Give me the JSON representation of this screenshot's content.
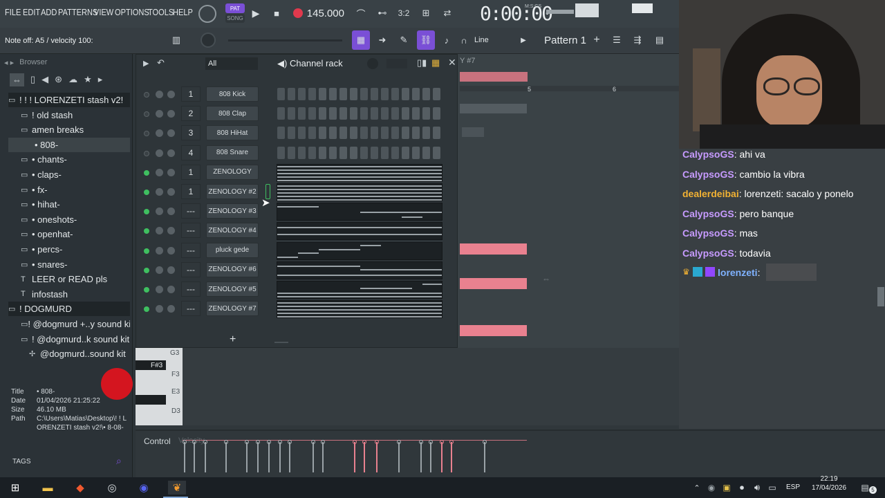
{
  "menu": [
    "FILE",
    "EDIT",
    "ADD",
    "PATTERNS",
    "VIEW",
    "OPTIONS",
    "TOOLS",
    "HELP"
  ],
  "transport": {
    "tempo": "145.000",
    "time": "0:00:00",
    "time_label": "M:S:CS",
    "pat_badge": "PAT",
    "song_badge": "SONG"
  },
  "hint": "Note off: A5 / velocity 100:",
  "toolbar": {
    "snap": "Line",
    "pattern": "Pattern 1"
  },
  "browser": {
    "title": "Browser",
    "items": [
      {
        "label": "! ! ! LORENZETI stash v2!",
        "kind": "folder"
      },
      {
        "label": "! old stash",
        "kind": "sub"
      },
      {
        "label": "amen  breaks",
        "kind": "sub"
      },
      {
        "label": "• 808-",
        "kind": "sel"
      },
      {
        "label": "• chants-",
        "kind": "sub"
      },
      {
        "label": "• claps-",
        "kind": "sub"
      },
      {
        "label": "• fx-",
        "kind": "sub"
      },
      {
        "label": "• hihat-",
        "kind": "sub"
      },
      {
        "label": "• oneshots-",
        "kind": "sub"
      },
      {
        "label": "• openhat-",
        "kind": "sub"
      },
      {
        "label": "• percs-",
        "kind": "sub"
      },
      {
        "label": "• snares-",
        "kind": "sub"
      },
      {
        "label": "LEER or READ pls",
        "kind": "file"
      },
      {
        "label": "infostash",
        "kind": "file"
      },
      {
        "label": "! DOGMURD",
        "kind": "folder"
      },
      {
        "label": "! @dogmurd +..y sound kit",
        "kind": "sub"
      },
      {
        "label": "! @dogmurd..k sound kit",
        "kind": "sub"
      },
      {
        "label": "@dogmurd..sound kit",
        "kind": "sub2"
      }
    ],
    "info": {
      "title_label": "Title",
      "title": "• 808-",
      "date_label": "Date",
      "date": "01/04/2026 21:25:22",
      "size_label": "Size",
      "size": "46.10 MB",
      "path_label": "Path",
      "path": "C:\\Users\\Matias\\Desktop\\! ! LORENZETI stash v2!\\• 8-08-"
    },
    "tags": "TAGS"
  },
  "rack": {
    "title": "Channel rack",
    "filter": "All",
    "channels": [
      {
        "num": "1",
        "name": "808 Kick",
        "mode": "steps",
        "led": "off"
      },
      {
        "num": "2",
        "name": "808 Clap",
        "mode": "steps",
        "led": "off"
      },
      {
        "num": "3",
        "name": "808 HiHat",
        "mode": "steps",
        "led": "off"
      },
      {
        "num": "4",
        "name": "808 Snare",
        "mode": "steps",
        "led": "off"
      },
      {
        "num": "1",
        "name": "ZENOLOGY",
        "mode": "roll",
        "led": "on"
      },
      {
        "num": "1",
        "name": "ZENOLOGY #2",
        "mode": "roll",
        "led": "on"
      },
      {
        "num": "---",
        "name": "ZENOLOGY #3",
        "mode": "roll",
        "led": "on"
      },
      {
        "num": "---",
        "name": "ZENOLOGY #4",
        "mode": "roll",
        "led": "on"
      },
      {
        "num": "---",
        "name": "pluck gede",
        "mode": "roll",
        "led": "on"
      },
      {
        "num": "---",
        "name": "ZENOLOGY #6",
        "mode": "roll",
        "led": "on"
      },
      {
        "num": "---",
        "name": "ZENOLOGY #5",
        "mode": "roll",
        "led": "on"
      },
      {
        "num": "---",
        "name": "ZENOLOGY #7",
        "mode": "roll",
        "led": "on"
      }
    ],
    "add": "+"
  },
  "playlist": {
    "track_label": "Y #7",
    "bar5": "5",
    "bar6": "6"
  },
  "piano": {
    "keys": [
      "G3",
      "F#3",
      "F3",
      "E3",
      "D3"
    ],
    "control": "Control",
    "velocity": "Velocity"
  },
  "chat": [
    {
      "user": "CalypsoGS",
      "msg": "ahi va",
      "color": "#c79bff"
    },
    {
      "user": "CalypsoGS",
      "msg": "cambio la vibra",
      "color": "#c79bff"
    },
    {
      "user": "dealerdeibai",
      "msg": "lorenzeti: sacalo y ponelo",
      "color": "#f2b233"
    },
    {
      "user": "CalypsoGS",
      "msg": "pero banque",
      "color": "#c79bff"
    },
    {
      "user": "CalypsoGS",
      "msg": "mas",
      "color": "#c79bff"
    },
    {
      "user": "CalypsoGS",
      "msg": "todavia",
      "color": "#c79bff"
    },
    {
      "user": "lorenzeti",
      "msg": "",
      "color": "#7fb2ff"
    }
  ],
  "taskbar": {
    "lang": "ESP",
    "time": "22:19",
    "date": "17/04/2026",
    "notif": "5"
  },
  "colors": {
    "accent": "#7a4fd6",
    "note_pink": "#e9818f",
    "led_green": "#3fbf60"
  }
}
